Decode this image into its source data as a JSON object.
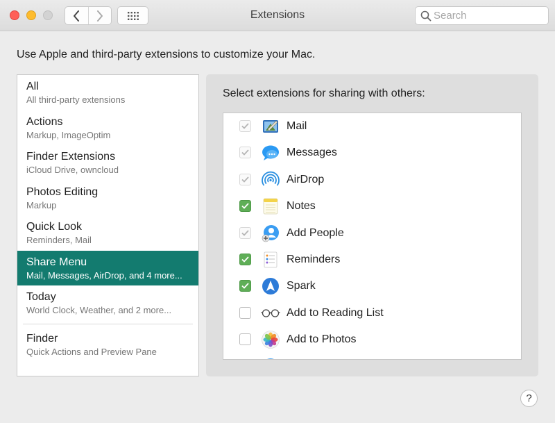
{
  "window": {
    "title": "Extensions",
    "search_placeholder": "Search"
  },
  "description": "Use Apple and third-party extensions to customize your Mac.",
  "sidebar": {
    "items": [
      {
        "title": "All",
        "subtitle": "All third-party extensions",
        "selected": false
      },
      {
        "title": "Actions",
        "subtitle": "Markup, ImageOptim",
        "selected": false
      },
      {
        "title": "Finder Extensions",
        "subtitle": "iCloud Drive, owncloud",
        "selected": false
      },
      {
        "title": "Photos Editing",
        "subtitle": "Markup",
        "selected": false
      },
      {
        "title": "Quick Look",
        "subtitle": "Reminders, Mail",
        "selected": false
      },
      {
        "title": "Share Menu",
        "subtitle": "Mail, Messages, AirDrop, and 4 more...",
        "selected": true
      },
      {
        "title": "Today",
        "subtitle": "World Clock, Weather, and 2 more...",
        "selected": false
      },
      {
        "title": "Finder",
        "subtitle": "Quick Actions and Preview Pane",
        "selected": false
      }
    ]
  },
  "panel": {
    "heading": "Select extensions for sharing with others:",
    "extensions": [
      {
        "name": "Mail",
        "icon": "mail-icon",
        "state": "checked-disabled"
      },
      {
        "name": "Messages",
        "icon": "messages-icon",
        "state": "checked-disabled"
      },
      {
        "name": "AirDrop",
        "icon": "airdrop-icon",
        "state": "checked-disabled"
      },
      {
        "name": "Notes",
        "icon": "notes-icon",
        "state": "checked"
      },
      {
        "name": "Add People",
        "icon": "add-people-icon",
        "state": "checked-disabled"
      },
      {
        "name": "Reminders",
        "icon": "reminders-icon",
        "state": "checked"
      },
      {
        "name": "Spark",
        "icon": "spark-icon",
        "state": "checked"
      },
      {
        "name": "Add to Reading List",
        "icon": "reading-list-icon",
        "state": "unchecked"
      },
      {
        "name": "Add to Photos",
        "icon": "photos-icon",
        "state": "unchecked"
      }
    ]
  },
  "help_label": "?",
  "colors": {
    "selection": "#137b6f",
    "checkbox_checked": "#5fae57"
  }
}
